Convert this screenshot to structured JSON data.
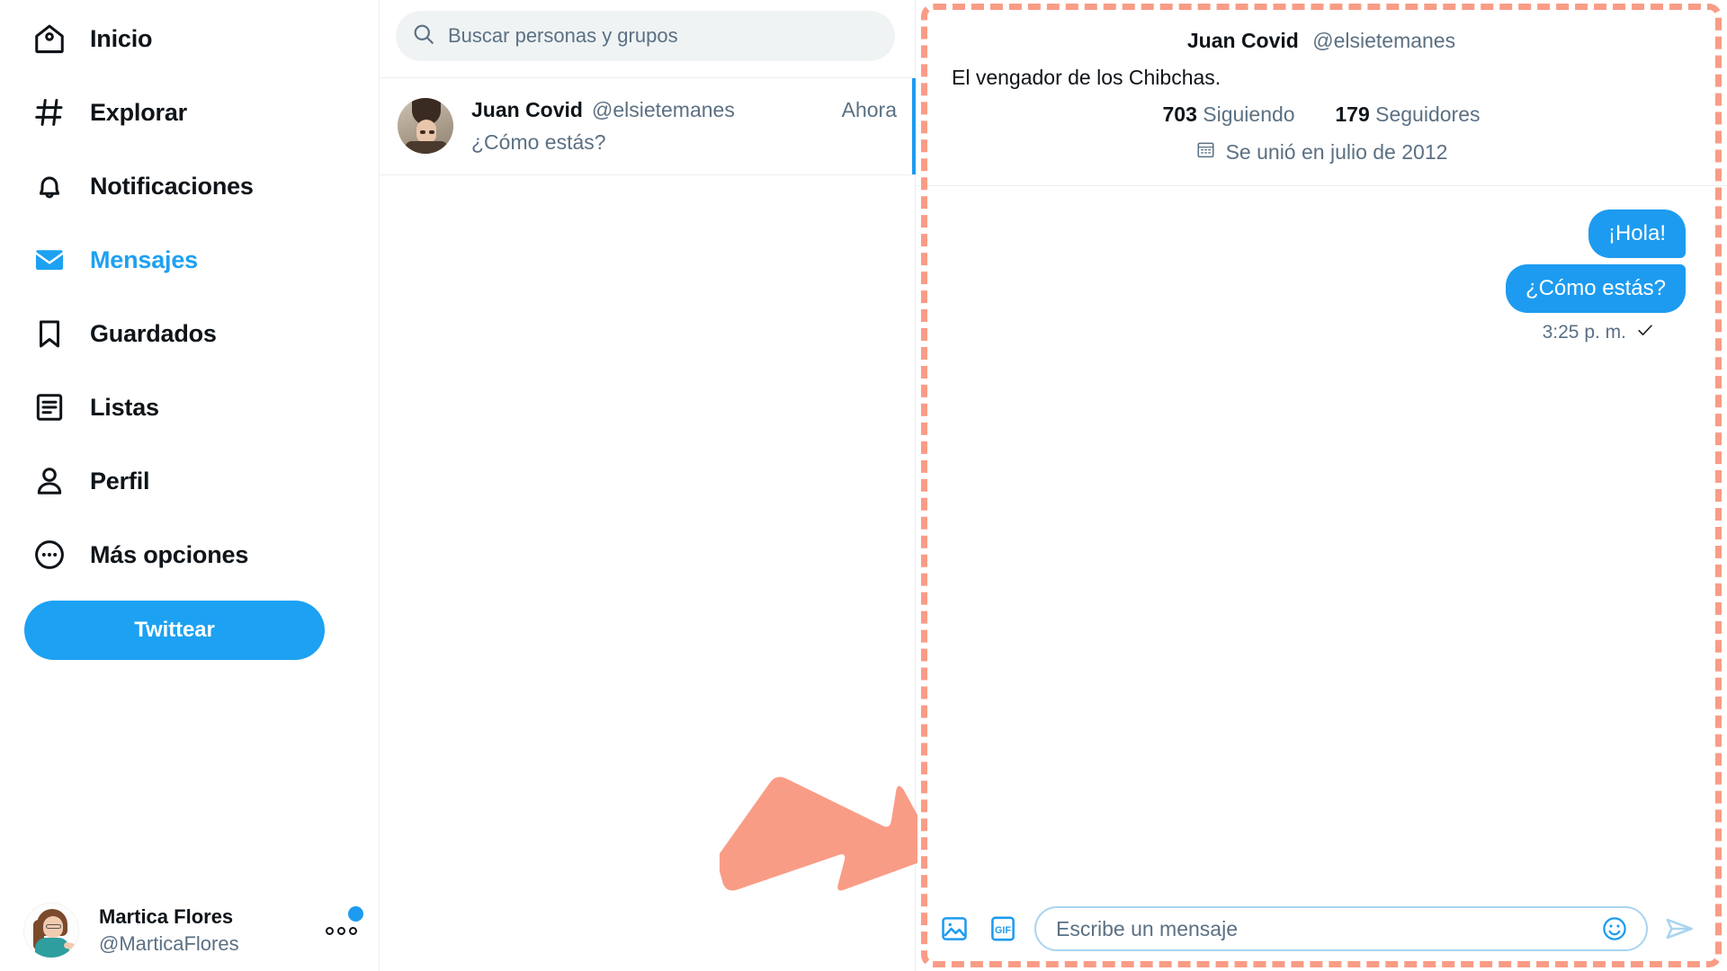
{
  "sidebar": {
    "items": [
      {
        "label": "Inicio",
        "icon": "home-icon",
        "active": false
      },
      {
        "label": "Explorar",
        "icon": "hashtag-icon",
        "active": false
      },
      {
        "label": "Notificaciones",
        "icon": "bell-icon",
        "active": false
      },
      {
        "label": "Mensajes",
        "icon": "envelope-icon",
        "active": true
      },
      {
        "label": "Guardados",
        "icon": "bookmark-icon",
        "active": false
      },
      {
        "label": "Listas",
        "icon": "list-icon",
        "active": false
      },
      {
        "label": "Perfil",
        "icon": "person-icon",
        "active": false
      },
      {
        "label": "Más opciones",
        "icon": "more-circle-icon",
        "active": false
      }
    ],
    "tweet_button": "Twittear",
    "account": {
      "name": "Martica Flores",
      "handle": "@MarticaFlores",
      "more_icon": "three-dots-icon",
      "has_badge": true
    }
  },
  "conversation_list": {
    "search_placeholder": "Buscar personas y grupos",
    "search_value": "",
    "search_icon": "search-icon",
    "items": [
      {
        "name": "Juan Covid",
        "handle": "@elsietemanes",
        "time": "Ahora",
        "preview": "¿Cómo estás?",
        "selected": true
      }
    ]
  },
  "chat": {
    "profile": {
      "name": "Juan Covid",
      "handle": "@elsietemanes",
      "bio": "El vengador de los Chibchas.",
      "following_count": "703",
      "following_label": "Siguiendo",
      "followers_count": "179",
      "followers_label": "Seguidores",
      "joined": "Se unió en julio de 2012",
      "joined_icon": "calendar-icon"
    },
    "messages": [
      {
        "text": "¡Hola!",
        "side": "out"
      },
      {
        "text": "¿Cómo estás?",
        "side": "out"
      }
    ],
    "timestamp": "3:25 p. m.",
    "status_icon": "check-icon",
    "composer": {
      "placeholder": "Escribe un mensaje",
      "value": "",
      "image_icon": "image-icon",
      "gif_icon": "gif-icon",
      "emoji_icon": "emoji-icon",
      "send_icon": "send-icon"
    }
  },
  "annotation": {
    "arrow_icon": "arrow-pointer-icon",
    "arrow_color": "#F99C86",
    "highlight_border_color": "#F99C86"
  },
  "colors": {
    "accent": "#1DA1F2",
    "bubble": "#1D9BF0",
    "muted_text": "#5B7083",
    "primary_text": "#0F1419",
    "divider": "#EBEEF0",
    "search_bg": "#EFF3F4"
  }
}
